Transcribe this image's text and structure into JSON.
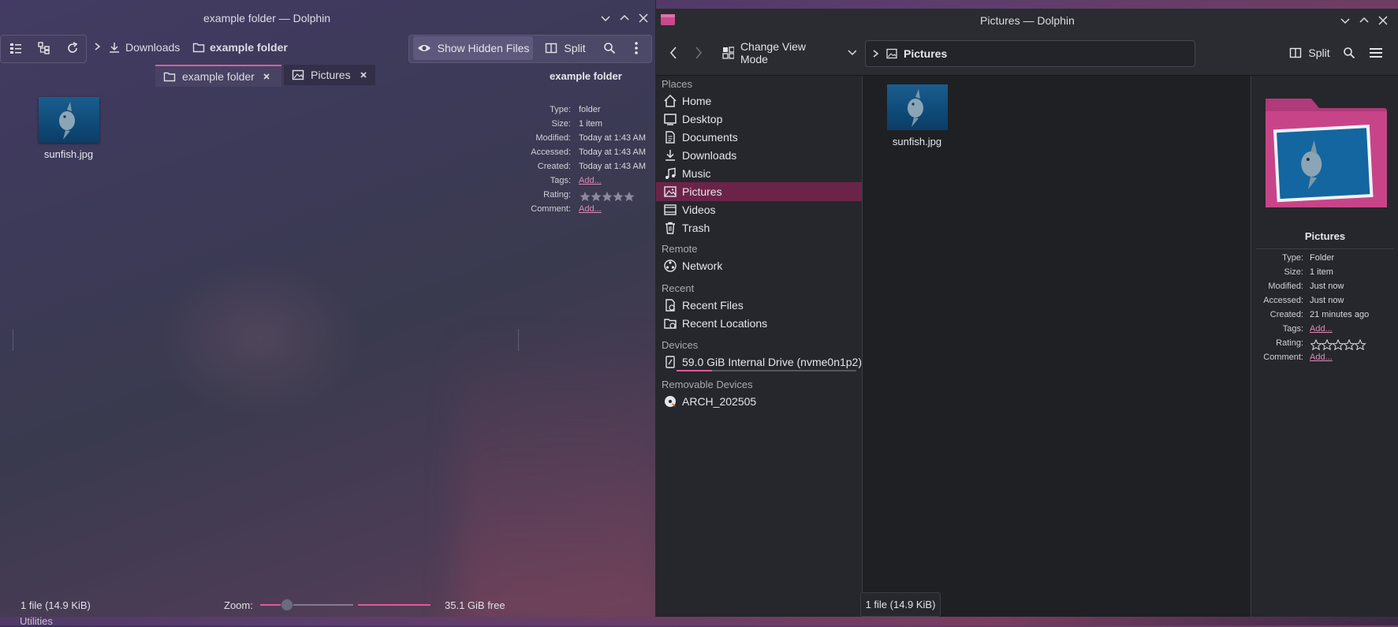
{
  "left_window": {
    "title": "example folder — Dolphin",
    "breadcrumb": [
      "Downloads",
      "example folder"
    ],
    "toolbar": {
      "show_hidden": "Show Hidden Files",
      "split": "Split"
    },
    "tabs": [
      {
        "label": "example folder"
      },
      {
        "label": "Pictures"
      }
    ],
    "file": {
      "name": "sunfish.jpg"
    },
    "info": {
      "title": "example folder",
      "rows": [
        {
          "key": "Type:",
          "value": "folder"
        },
        {
          "key": "Size:",
          "value": "1 item"
        },
        {
          "key": "Modified:",
          "value": "Today at 1:43 AM"
        },
        {
          "key": "Accessed:",
          "value": "Today at 1:43 AM"
        },
        {
          "key": "Created:",
          "value": "Today at 1:43 AM"
        },
        {
          "key": "Tags:",
          "value": "Add..."
        },
        {
          "key": "Rating:",
          "value": ""
        },
        {
          "key": "Comment:",
          "value": "Add..."
        }
      ]
    },
    "status": {
      "files": "1 file (14.9 KiB)",
      "zoom_label": "Zoom:",
      "free": "35.1 GiB free"
    }
  },
  "right_window": {
    "title": "Pictures — Dolphin",
    "toolbar": {
      "view_mode": "Change View Mode",
      "split": "Split",
      "location": "Pictures"
    },
    "places": {
      "sections": [
        {
          "title": "Places",
          "items": [
            {
              "label": "Home",
              "icon": "home-icon"
            },
            {
              "label": "Desktop",
              "icon": "desktop-icon"
            },
            {
              "label": "Documents",
              "icon": "documents-icon"
            },
            {
              "label": "Downloads",
              "icon": "download-icon"
            },
            {
              "label": "Music",
              "icon": "music-icon"
            },
            {
              "label": "Pictures",
              "icon": "pictures-icon",
              "selected": true
            },
            {
              "label": "Videos",
              "icon": "videos-icon"
            },
            {
              "label": "Trash",
              "icon": "trash-icon"
            }
          ]
        },
        {
          "title": "Remote",
          "items": [
            {
              "label": "Network",
              "icon": "network-icon"
            }
          ]
        },
        {
          "title": "Recent",
          "items": [
            {
              "label": "Recent Files",
              "icon": "recent-files-icon"
            },
            {
              "label": "Recent Locations",
              "icon": "recent-locations-icon"
            }
          ]
        },
        {
          "title": "Devices",
          "items": [
            {
              "label": "59.0 GiB Internal Drive (nvme0n1p2)",
              "icon": "drive-icon"
            }
          ]
        },
        {
          "title": "Removable Devices",
          "items": [
            {
              "label": "ARCH_202505",
              "icon": "optical-disc-icon"
            }
          ]
        }
      ]
    },
    "file": {
      "name": "sunfish.jpg"
    },
    "info": {
      "title": "Pictures",
      "rows": [
        {
          "key": "Type:",
          "value": "Folder"
        },
        {
          "key": "Size:",
          "value": "1 item"
        },
        {
          "key": "Modified:",
          "value": "Just now"
        },
        {
          "key": "Accessed:",
          "value": "Just now"
        },
        {
          "key": "Created:",
          "value": "21 minutes ago"
        },
        {
          "key": "Tags:",
          "value": "Add..."
        },
        {
          "key": "Rating:",
          "value": ""
        },
        {
          "key": "Comment:",
          "value": "Add..."
        }
      ]
    },
    "status": {
      "files": "1 file (14.9 KiB)"
    }
  },
  "taskbar": {
    "partial_label": "Utilities"
  },
  "colors": {
    "accent": "#e05a9a",
    "selection": "#6b2448",
    "link": "#e28ab8"
  }
}
